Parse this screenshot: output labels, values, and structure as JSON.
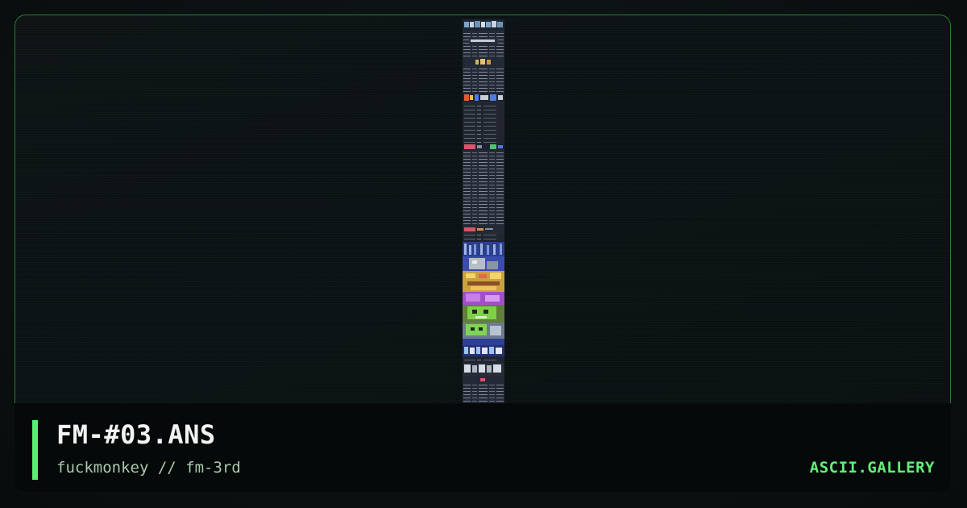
{
  "card": {
    "title": "FM-#03.ANS",
    "subtitle": "fuckmonkey // fm-3rd",
    "brand": "ASCII.GALLERY"
  },
  "colors": {
    "accent": "#57f072",
    "brand": "#63ef7a",
    "frame_border": "#2c7a35",
    "background": "#0b1112",
    "footer_background": "#060909"
  },
  "artwork": {
    "icon": "ansi-art-thumbnail"
  }
}
